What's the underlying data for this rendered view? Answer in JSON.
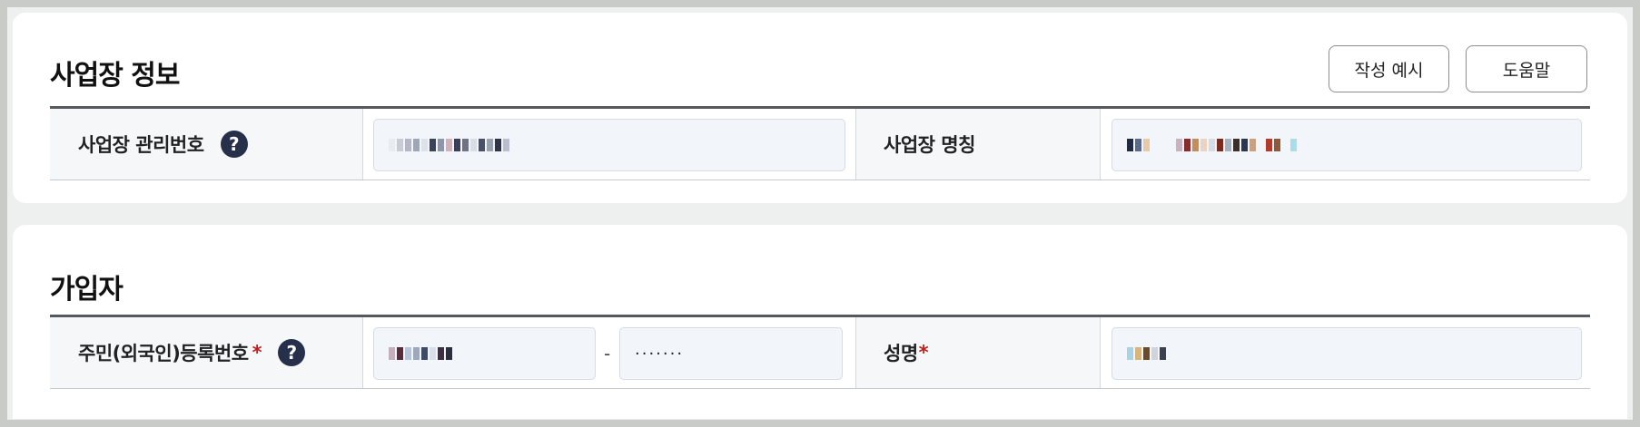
{
  "business_section": {
    "title": "사업장 정보",
    "buttons": {
      "example": "작성 예시",
      "help": "도움말"
    },
    "row": {
      "mgmt_label": "사업장 관리번호",
      "mgmt_help_glyph": "?",
      "mgmt_value": "",
      "name_label": "사업장 명칭",
      "name_value": ""
    }
  },
  "subscriber_section": {
    "title": "가입자",
    "row": {
      "rrn_label": "주민(외국인)등록번호",
      "rrn_required": "*",
      "rrn_help_glyph": "?",
      "rrn_front_value": "",
      "rrn_separator": "-",
      "rrn_back_value": "·······",
      "name_label": "성명",
      "name_required": "*",
      "name_value": ""
    }
  },
  "colors": {
    "help_icon_bg": "#27304a",
    "required_mark": "#c21c1c",
    "input_bg": "#f2f6fb",
    "label_bg": "#f5f7f8",
    "row_top_border": "#55595d"
  }
}
